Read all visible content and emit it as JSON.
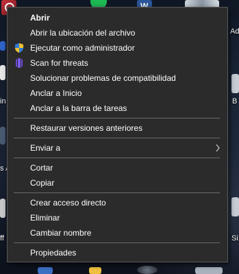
{
  "desktop": {
    "edge_labels": [
      {
        "text": "Ad"
      },
      {
        "text": "in"
      },
      {
        "text": "B"
      },
      {
        "text": "s A"
      },
      {
        "text": "ff"
      },
      {
        "text": "Si"
      }
    ]
  },
  "context_menu": {
    "items": [
      {
        "label": "Abrir",
        "bold": true
      },
      {
        "label": "Abrir la ubicación del archivo"
      },
      {
        "label": "Ejecutar como administrador",
        "icon": "uac-shield-icon"
      },
      {
        "label": "Scan for threats",
        "icon": "antivirus-scan-icon"
      },
      {
        "label": "Solucionar problemas de compatibilidad"
      },
      {
        "label": "Anclar a Inicio"
      },
      {
        "label": "Anclar a la barra de tareas"
      },
      {
        "label": "Restaurar versiones anteriores"
      },
      {
        "label": "Enviar a",
        "submenu": true
      },
      {
        "label": "Cortar"
      },
      {
        "label": "Copiar"
      },
      {
        "label": "Crear acceso directo"
      },
      {
        "label": "Eliminar"
      },
      {
        "label": "Cambiar nombre"
      },
      {
        "label": "Propiedades"
      }
    ]
  },
  "colors": {
    "menu_background": "#2b2b2b",
    "menu_border": "#5a5a5a",
    "separator": "#6b6b6b",
    "text": "#ffffff",
    "shield_blue": "#2f7bd6",
    "shield_yellow": "#f2c12e",
    "scan_purple": "#6b4bd8"
  }
}
